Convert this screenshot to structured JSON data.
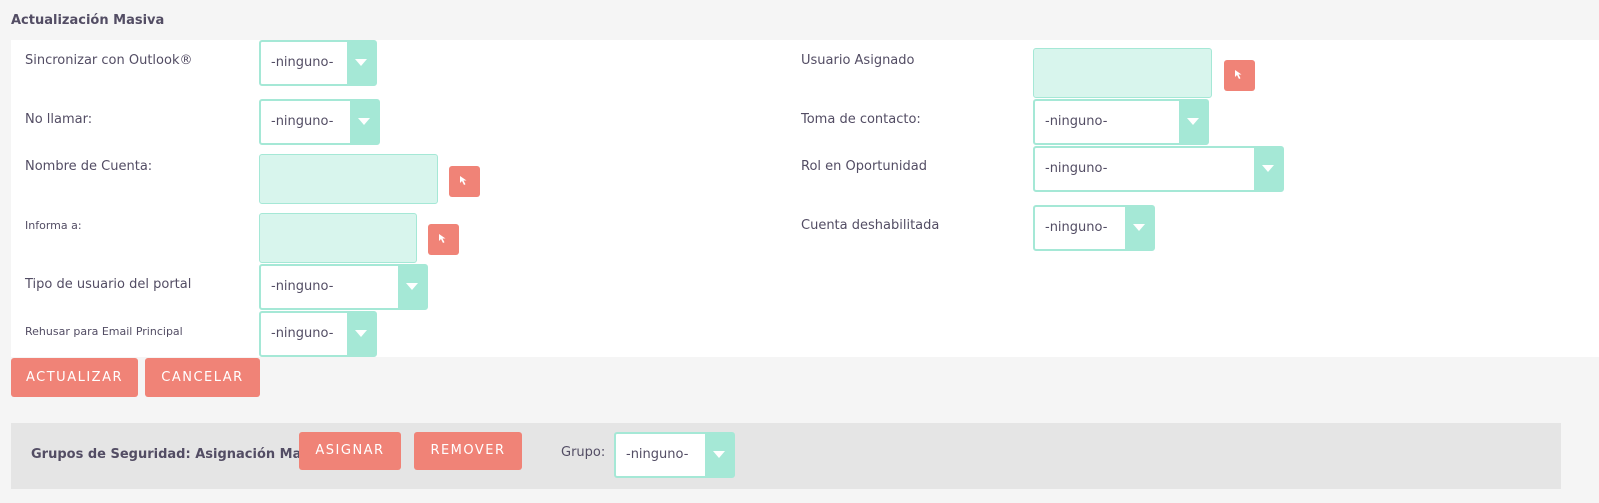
{
  "title": "Actualización Masiva",
  "fields": {
    "sync_outlook": {
      "label": "Sincronizar con Outlook®",
      "value": "-ninguno-"
    },
    "no_llamar": {
      "label": "No llamar:",
      "value": "-ninguno-"
    },
    "nombre_cuenta": {
      "label": "Nombre de Cuenta:",
      "value": ""
    },
    "informa_a": {
      "label": "Informa a:",
      "value": ""
    },
    "tipo_usuario_portal": {
      "label": "Tipo de usuario del portal",
      "value": "-ninguno-"
    },
    "rehusar_email": {
      "label": "Rehusar para Email Principal",
      "value": "-ninguno-"
    },
    "usuario_asignado": {
      "label": "Usuario Asignado",
      "value": ""
    },
    "toma_contacto": {
      "label": "Toma de contacto:",
      "value": "-ninguno-"
    },
    "rol_oportunidad": {
      "label": "Rol en Oportunidad",
      "value": "-ninguno-"
    },
    "cuenta_deshabilitada": {
      "label": "Cuenta deshabilitada",
      "value": "-ninguno-"
    }
  },
  "buttons": {
    "actualizar": "ACTUALIZAR",
    "cancelar": "CANCELAR"
  },
  "security": {
    "label": "Grupos de Seguridad: Asignación Masiva",
    "asignar": "ASIGNAR",
    "remover": "REMOVER",
    "grupo_label": "Grupo:",
    "grupo_value": "-ninguno-"
  },
  "colors": {
    "accent": "#f08377",
    "select_border": "#a5e8d6",
    "text_input_bg": "#d8f5ed",
    "text": "#534d64"
  },
  "icons": {
    "select_picker": "cursor-arrow-icon",
    "dropdown": "caret-down-icon"
  }
}
